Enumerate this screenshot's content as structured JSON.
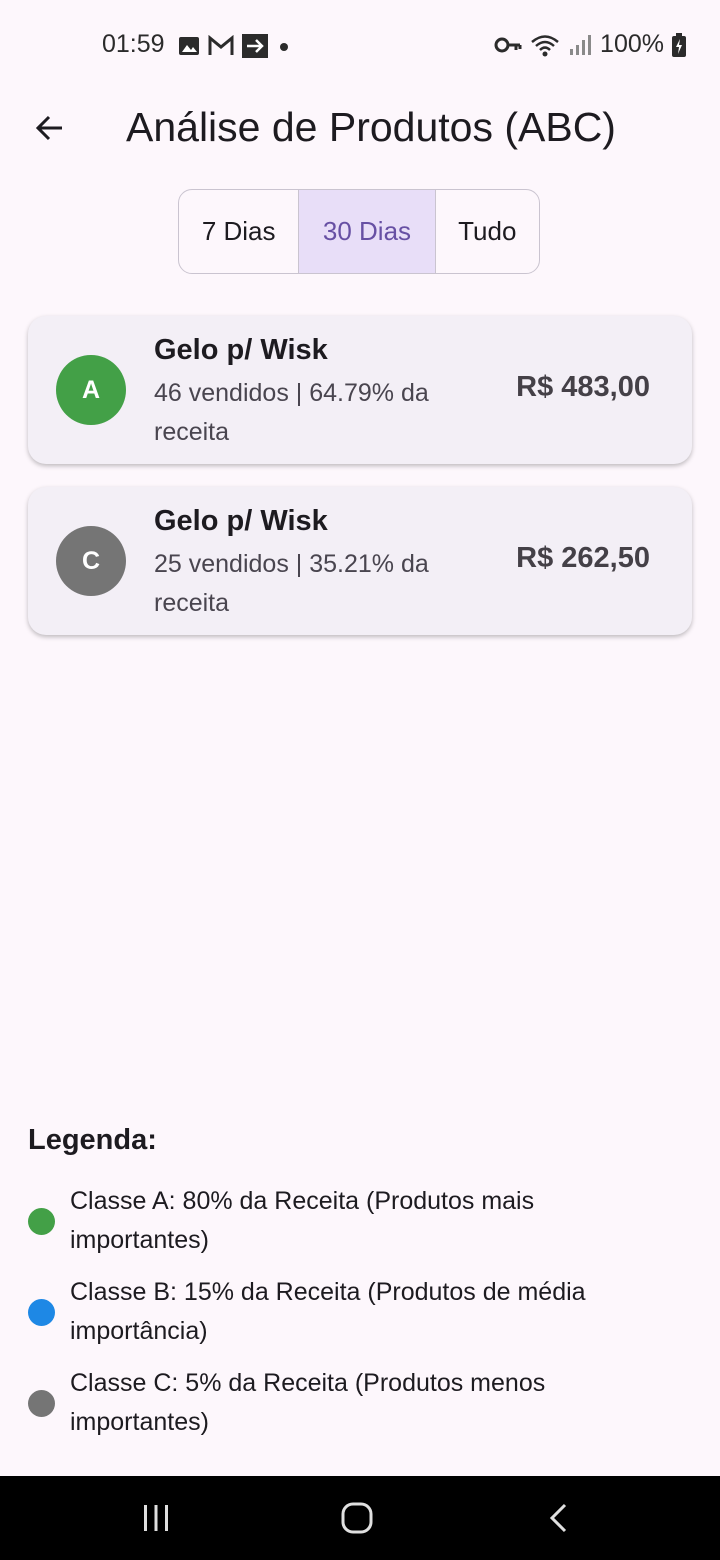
{
  "status_bar": {
    "time": "01:59",
    "battery": "100%",
    "left_icons": [
      "image-icon",
      "gmail-icon",
      "forward-box-icon",
      "dot-icon"
    ],
    "right_icons": [
      "vpn-key-icon",
      "wifi-icon",
      "signal-icon",
      "battery-charging-icon"
    ]
  },
  "app_bar": {
    "title": "Análise de Produtos (ABC)",
    "back_icon": "arrow-back-icon"
  },
  "period_filter": {
    "options": [
      {
        "label": "7 Dias",
        "selected": false
      },
      {
        "label": "30 Dias",
        "selected": true
      },
      {
        "label": "Tudo",
        "selected": false
      }
    ]
  },
  "products": [
    {
      "class": "A",
      "class_color": "#43a047",
      "name": "Gelo p/ Wisk",
      "subtitle": "46 vendidos | 64.79% da receita",
      "revenue": "R$ 483,00"
    },
    {
      "class": "C",
      "class_color": "#757575",
      "name": "Gelo p/ Wisk",
      "subtitle": "25 vendidos | 35.21% da receita",
      "revenue": "R$ 262,50"
    }
  ],
  "legend": {
    "title": "Legenda:",
    "items": [
      {
        "color": "#43a047",
        "text": "Classe A: 80% da Receita (Produtos mais importantes)"
      },
      {
        "color": "#1e88e5",
        "text": "Classe B: 15% da Receita (Produtos de média importância)"
      },
      {
        "color": "#757575",
        "text": "Classe C: 5% da Receita (Produtos menos importantes)"
      }
    ]
  },
  "colors": {
    "background": "#fdf7fc",
    "card": "#f3eff6",
    "selected_segment": "#e8def8",
    "accent": "#6750a4"
  },
  "nav_bar": {
    "icons": [
      "recent-apps-icon",
      "home-icon",
      "back-nav-icon"
    ]
  }
}
